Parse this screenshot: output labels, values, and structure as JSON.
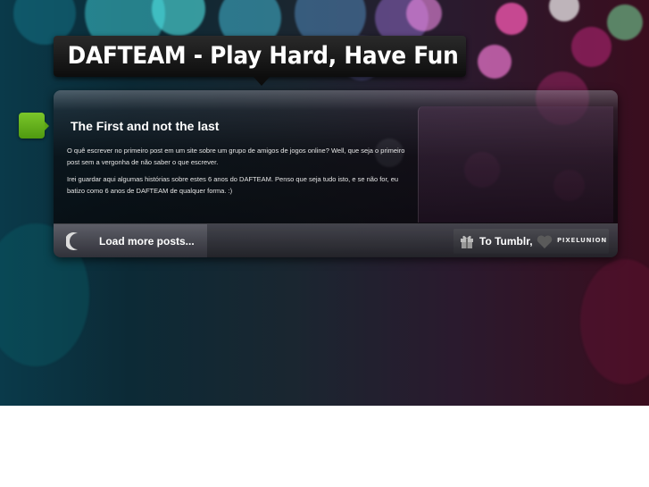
{
  "header": {
    "title": "DAFTEAM - Play Hard, Have Fun"
  },
  "post": {
    "icon": "document-icon",
    "title": "The First and not the last",
    "paragraphs": [
      "O quê escrever no primeiro post em um site sobre um grupo de amigos de jogos online? Well, que seja o primeiro post sem a vergonha de não saber o que escrever.",
      "Irei guardar aqui algumas histórias sobre estes 6 anos do DAFTEAM. Penso que seja tudo isto, e se não for, eu batizo como 6 anos de DAFTEAM de qualquer forma. :)"
    ]
  },
  "footer": {
    "load_more_label": "Load more posts...",
    "tumblr_label": "To Tumblr,",
    "credit_label": "PIXELUNION",
    "icons": [
      "spinner-icon",
      "gift-icon",
      "heart-icon"
    ]
  },
  "colors": {
    "accent_green": "#6cb820",
    "title_bg": "#111111"
  }
}
